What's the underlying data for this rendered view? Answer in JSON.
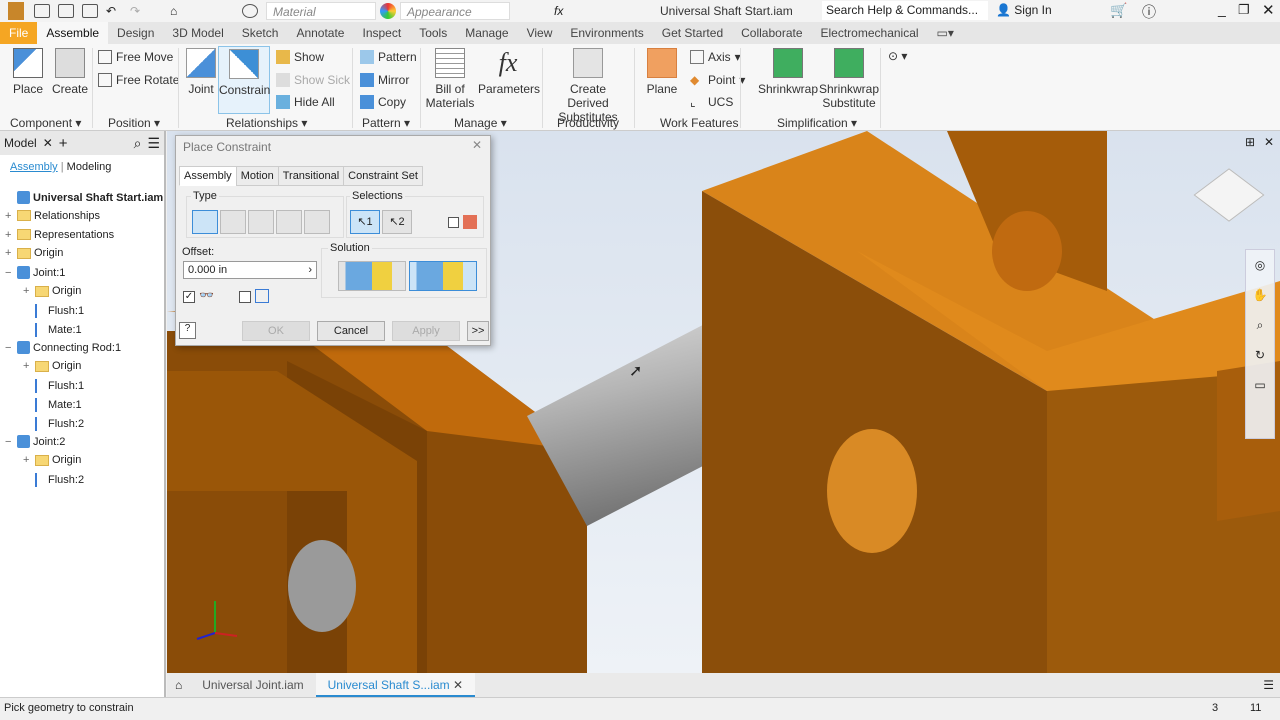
{
  "titlebar": {
    "material": "Material",
    "appearance": "Appearance",
    "title": "Universal Shaft Start.iam",
    "search_placeholder": "Search Help & Commands...",
    "sign_in": "Sign In"
  },
  "tabs": [
    "File",
    "Assemble",
    "Design",
    "3D Model",
    "Sketch",
    "Annotate",
    "Inspect",
    "Tools",
    "Manage",
    "View",
    "Environments",
    "Get Started",
    "Collaborate",
    "Electromechanical"
  ],
  "ribbon": {
    "place": "Place",
    "create": "Create",
    "free_move": "Free Move",
    "free_rotate": "Free Rotate",
    "joint": "Joint",
    "constrain": "Constrain",
    "show": "Show",
    "show_sick": "Show Sick",
    "hide_all": "Hide All",
    "pattern": "Pattern",
    "mirror": "Mirror",
    "copy": "Copy",
    "bom": "Bill of Materials",
    "parameters": "Parameters",
    "create_derived": "Create Derived Substitutes",
    "plane": "Plane",
    "axis": "Axis",
    "point": "Point",
    "ucs": "UCS",
    "shrinkwrap": "Shrinkwrap",
    "shrinkwrap_sub": "Shrinkwrap Substitute",
    "panels": [
      "Component",
      "Position",
      "Relationships",
      "Pattern",
      "Manage",
      "Productivity",
      "Work Features",
      "Simplification"
    ]
  },
  "browser": {
    "tab": "Model",
    "subtabs": [
      "Assembly",
      "Modeling"
    ],
    "tree": [
      {
        "label": "Universal Shaft Start.iam",
        "level": 0,
        "type": "assembly",
        "expander": ""
      },
      {
        "label": "Relationships",
        "level": 0,
        "type": "folder",
        "expander": "+"
      },
      {
        "label": "Representations",
        "level": 0,
        "type": "folder",
        "expander": "+"
      },
      {
        "label": "Origin",
        "level": 0,
        "type": "folder",
        "expander": "+"
      },
      {
        "label": "Joint:1",
        "level": 0,
        "type": "part",
        "expander": "−"
      },
      {
        "label": "Origin",
        "level": 1,
        "type": "folder",
        "expander": "+"
      },
      {
        "label": "Flush:1",
        "level": 1,
        "type": "constraint",
        "expander": ""
      },
      {
        "label": "Mate:1",
        "level": 1,
        "type": "constraint",
        "expander": ""
      },
      {
        "label": "Connecting Rod:1",
        "level": 0,
        "type": "part",
        "expander": "−"
      },
      {
        "label": "Origin",
        "level": 1,
        "type": "folder",
        "expander": "+"
      },
      {
        "label": "Flush:1",
        "level": 1,
        "type": "constraint",
        "expander": ""
      },
      {
        "label": "Mate:1",
        "level": 1,
        "type": "constraint",
        "expander": ""
      },
      {
        "label": "Flush:2",
        "level": 1,
        "type": "constraint",
        "expander": ""
      },
      {
        "label": "Joint:2",
        "level": 0,
        "type": "part",
        "expander": "−"
      },
      {
        "label": "Origin",
        "level": 1,
        "type": "folder",
        "expander": "+"
      },
      {
        "label": "Flush:2",
        "level": 1,
        "type": "constraint",
        "expander": ""
      }
    ]
  },
  "dialog": {
    "title": "Place Constraint",
    "tabs": [
      "Assembly",
      "Motion",
      "Transitional",
      "Constraint Set"
    ],
    "type_label": "Type",
    "selections_label": "Selections",
    "sel1": "1",
    "sel2": "2",
    "offset_label": "Offset:",
    "offset_value": "0.000 in",
    "solution_label": "Solution",
    "ok": "OK",
    "cancel": "Cancel",
    "apply": "Apply",
    "more": ">>",
    "show_preview_checked": true,
    "predict_offset_checked": false
  },
  "doc_tabs": [
    "Universal Joint.iam",
    "Universal Shaft S...iam"
  ],
  "status": {
    "message": "Pick geometry to constrain",
    "num1": "3",
    "num2": "11"
  },
  "colors": {
    "accent": "#2a8bd0",
    "part_orange": "#d97a10",
    "file_tab": "#f5a623"
  }
}
